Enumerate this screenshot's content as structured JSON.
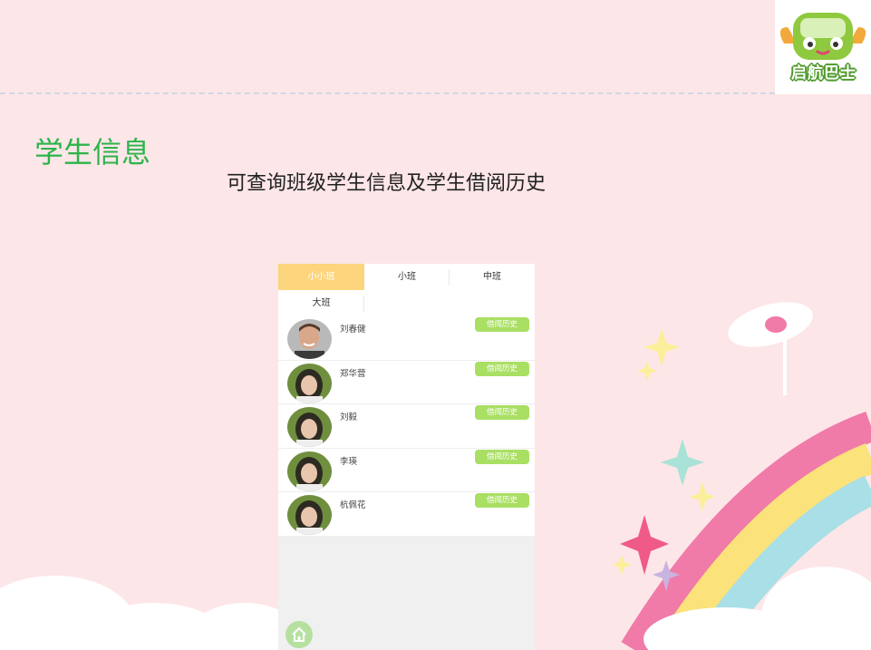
{
  "logo": {
    "text": "启航巴士",
    "colors": {
      "green": "#4f9a2c",
      "wing": "#f2a93b"
    }
  },
  "slide": {
    "title": "学生信息",
    "subtitle": "可查询班级学生信息及学生借阅历史",
    "colors": {
      "background": "#fde6e8",
      "title": "#2cb44a",
      "dash": "#cfd8e2"
    }
  },
  "phone": {
    "tabs": [
      {
        "label": "小小班",
        "active": true
      },
      {
        "label": "小班",
        "active": false
      },
      {
        "label": "中班",
        "active": false
      },
      {
        "label": "大班",
        "active": false
      }
    ],
    "active_tab_color": "#fcd57c",
    "students": [
      {
        "name": "刘春健",
        "button": "借阅历史",
        "avatar": "male-portrait"
      },
      {
        "name": "郑华营",
        "button": "借阅历史",
        "avatar": "girl-portrait"
      },
      {
        "name": "刘毅",
        "button": "借阅历史",
        "avatar": "girl-portrait"
      },
      {
        "name": "李瑛",
        "button": "借阅历史",
        "avatar": "girl-portrait"
      },
      {
        "name": "杭佩花",
        "button": "借阅历史",
        "avatar": "girl-portrait"
      }
    ],
    "button_color": "#a9df63",
    "home_icon": "home-icon"
  }
}
